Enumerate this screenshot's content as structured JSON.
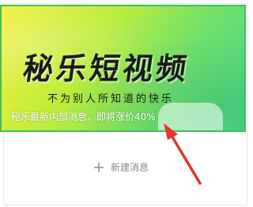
{
  "banner": {
    "logo_text": "秘乐短视频",
    "slogan": "不为别人所知道的快乐",
    "caption": "秘乐最新内部消息，即将涨价40%"
  },
  "actions": {
    "new_message_label": "新建消息"
  },
  "icons": {
    "new_message": "plus-icon",
    "annotation": "red-arrow-icon"
  },
  "colors": {
    "banner_border": "#3fbf5a",
    "annotation_arrow": "#e8332b",
    "muted_text": "#888888"
  }
}
